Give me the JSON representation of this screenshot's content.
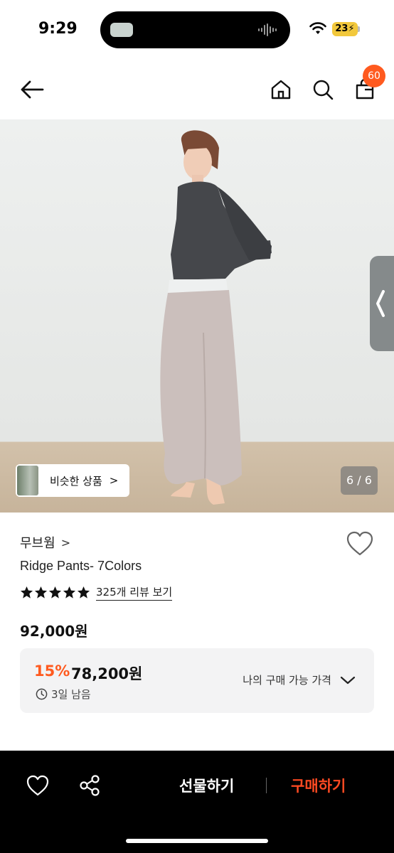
{
  "status": {
    "time": "9:29",
    "battery": "23"
  },
  "header": {
    "cart_count": "60"
  },
  "gallery": {
    "similar_label": "비슷한 상품",
    "similar_chevron": ">",
    "counter": "6 / 6"
  },
  "product": {
    "brand": "무브웜",
    "brand_chevron": ">",
    "name": "Ridge Pants- 7Colors",
    "rating": 5,
    "review_link": "325개 리뷰 보기",
    "original_price": "92,000원",
    "discount_rate": "15%",
    "sale_price": "78,200원",
    "time_left": "3일 남음",
    "my_price_label": "나의 구매 가능 가격"
  },
  "bottom_bar": {
    "gift_label": "선물하기",
    "buy_label": "구매하기"
  },
  "colors": {
    "accent": "#ff5a1f",
    "buy": "#ff4a22",
    "bar_bg": "#000000"
  }
}
